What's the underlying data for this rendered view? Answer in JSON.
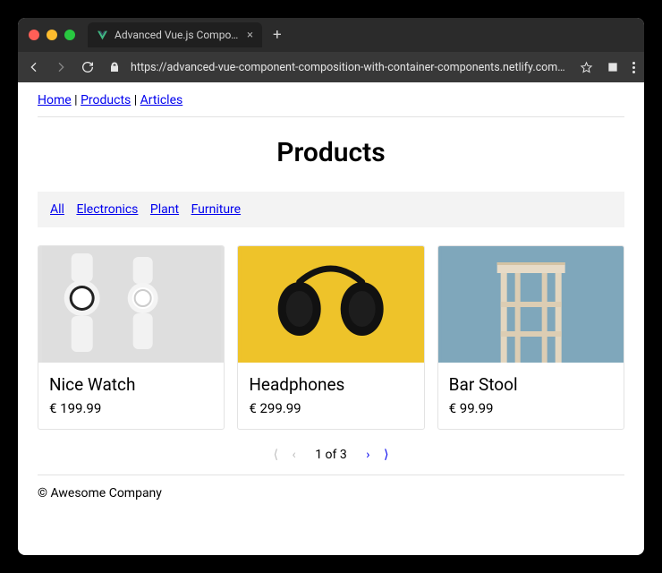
{
  "browser": {
    "tab_title": "Advanced Vue.js Component C",
    "url": "https://advanced-vue-component-composition-with-container-components.netlify.com/prod…"
  },
  "nav": {
    "items": [
      "Home",
      "Products",
      "Articles"
    ]
  },
  "page_title": "Products",
  "filters": [
    "All",
    "Electronics",
    "Plant",
    "Furniture"
  ],
  "products": [
    {
      "name": "Nice Watch",
      "price": "€ 199.99"
    },
    {
      "name": "Headphones",
      "price": "€ 299.99"
    },
    {
      "name": "Bar Stool",
      "price": "€ 99.99"
    }
  ],
  "pagination": {
    "label": "1 of 3"
  },
  "footer": "© Awesome Company"
}
